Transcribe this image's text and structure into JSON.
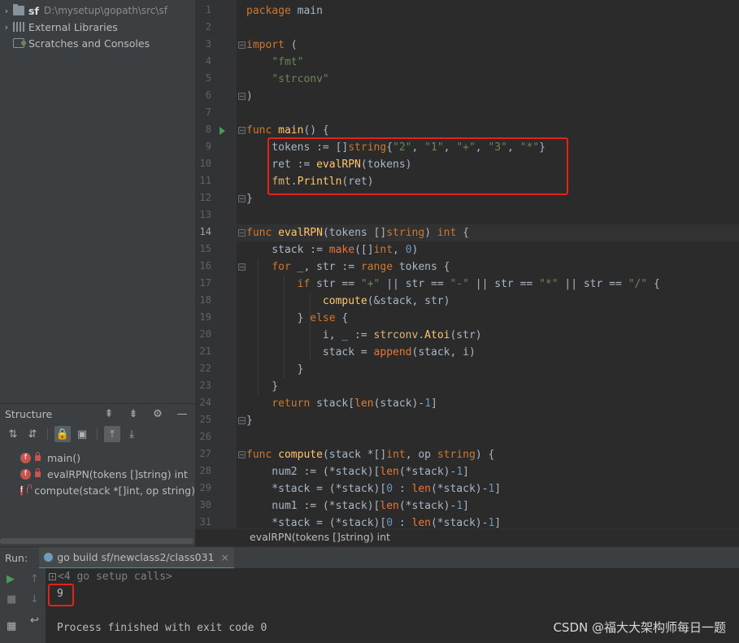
{
  "project": {
    "root_name": "sf",
    "root_path": "D:\\mysetup\\gopath\\src\\sf",
    "items": [
      {
        "label": "External Libraries"
      },
      {
        "label": "Scratches and Consoles"
      }
    ]
  },
  "structure": {
    "title": "Structure",
    "items": [
      {
        "badge": "f",
        "label": "main()"
      },
      {
        "badge": "f",
        "label": "evalRPN(tokens []string) int"
      },
      {
        "badge": "f",
        "label": "compute(stack *[]int, op string)"
      }
    ]
  },
  "editor": {
    "line_numbers": [
      "1",
      "2",
      "3",
      "4",
      "5",
      "6",
      "7",
      "8",
      "9",
      "10",
      "11",
      "12",
      "13",
      "14",
      "15",
      "16",
      "17",
      "18",
      "19",
      "20",
      "21",
      "22",
      "23",
      "24",
      "25",
      "26",
      "27",
      "28",
      "29",
      "30",
      "31"
    ],
    "current_line": "14",
    "lines": [
      "package main",
      "",
      "import (",
      "    \"fmt\"",
      "    \"strconv\"",
      ")",
      "",
      "func main() {",
      "    tokens := []string{\"2\", \"1\", \"+\", \"3\", \"*\"}",
      "    ret := evalRPN(tokens)",
      "    fmt.Println(ret)",
      "}",
      "",
      "func evalRPN(tokens []string) int {",
      "    stack := make([]int, 0)",
      "    for _, str := range tokens {",
      "        if str == \"+\" || str == \"-\" || str == \"*\" || str == \"/\" {",
      "            compute(&stack, str)",
      "        } else {",
      "            i, _ := strconv.Atoi(str)",
      "            stack = append(stack, i)",
      "        }",
      "    }",
      "    return stack[len(stack)-1]",
      "}",
      "",
      "func compute(stack *[]int, op string) {",
      "    num2 := (*stack)[len(*stack)-1]",
      "    *stack = (*stack)[0 : len(*stack)-1]",
      "    num1 := (*stack)[len(*stack)-1]",
      "    *stack = (*stack)[0 : len(*stack)-1]"
    ],
    "breadcrumb": "evalRPN(tokens []string) int"
  },
  "run": {
    "label": "Run:",
    "tab_label": "go build sf/newclass2/class031",
    "close_glyph": "×",
    "setup_calls": "<4 go setup calls>",
    "output": "9",
    "exit_message": "Process finished with exit code 0"
  },
  "watermark": "CSDN @福大大架构师每日一题",
  "colors": {
    "accent": "#4a88c7",
    "highlight_box": "#e62117",
    "keyword": "#cc7832",
    "string": "#6a8759",
    "function": "#ffc66d"
  }
}
